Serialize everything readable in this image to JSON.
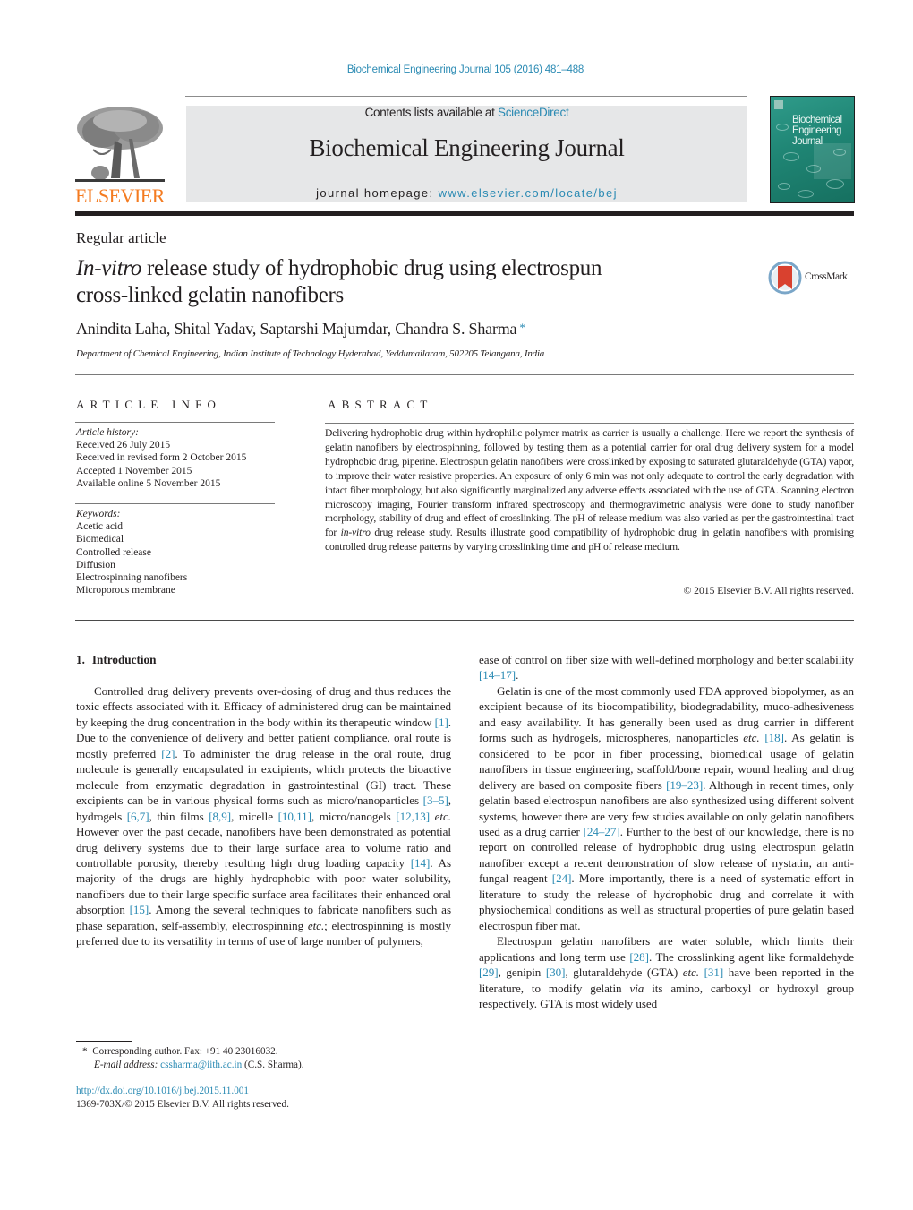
{
  "header": {
    "journal_ref": "Biochemical Engineering Journal 105 (2016) 481–488",
    "publisher_logo_text": "ELSEVIER",
    "contents_prefix": "Contents lists available at ",
    "contents_link": "ScienceDirect",
    "journal_title": "Biochemical Engineering Journal",
    "homepage_prefix": "journal homepage: ",
    "homepage_link": "www.elsevier.com/locate/bej",
    "cover_title_lines": [
      "Biochemical",
      "Engineering",
      "Journal"
    ],
    "crossmark_label": "CrossMark"
  },
  "colors": {
    "link": "#2a8ab3",
    "elsevier_orange": "#f47b20",
    "masthead_bg": "#e6e7e8",
    "cover_teal": "#1f8574",
    "text": "#231f20"
  },
  "article": {
    "type": "Regular article",
    "title_italic": "In-vitro",
    "title_rest_line1": " release study of hydrophobic drug using electrospun",
    "title_line2": "cross-linked gelatin nanofibers",
    "authors": "Anindita Laha, Shital Yadav, Saptarshi Majumdar, Chandra S. Sharma",
    "author_mark": "*",
    "affiliation": "Department of Chemical Engineering, Indian Institute of Technology Hyderabad, Yeddumailaram, 502205 Telangana, India"
  },
  "article_info": {
    "heading": "ARTICLE INFO",
    "history_label": "Article history:",
    "history": [
      "Received 26 July 2015",
      "Received in revised form 2 October 2015",
      "Accepted 1 November 2015",
      "Available online 5 November 2015"
    ],
    "keywords_label": "Keywords:",
    "keywords": [
      "Acetic acid",
      "Biomedical",
      "Controlled release",
      "Diffusion",
      "Electrospinning nanofibers",
      "Microporous membrane"
    ]
  },
  "abstract": {
    "heading": "ABSTRACT",
    "part1": "Delivering hydrophobic drug within hydrophilic polymer matrix as carrier is usually a challenge. Here we report the synthesis of gelatin nanofibers by electrospinning, followed by testing them as a potential carrier for oral drug delivery system for a model hydrophobic drug, piperine. Electrospun gelatin nanofibers were crosslinked by exposing to saturated glutaraldehyde (GTA) vapor, to improve their water resistive properties. An exposure of only 6 min was not only adequate to control the early degradation with intact fiber morphology, but also significantly marginalized any adverse effects associated with the use of GTA. Scanning electron microscopy imaging, Fourier transform infrared spectroscopy and thermogravimetric analysis were done to study nanofiber morphology, stability of drug and effect of crosslinking. The pH of release medium was also varied as per the gastrointestinal tract for ",
    "italic": "in-vitro",
    "part2": " drug release study. Results illustrate good compatibility of hydrophobic drug in gelatin nanofibers with promising controlled drug release patterns by varying crosslinking time and pH of release medium.",
    "copyright": "© 2015 Elsevier B.V. All rights reserved."
  },
  "body": {
    "section_number": "1.",
    "section_title": "Introduction",
    "left_p1": [
      {
        "t": "Controlled drug delivery prevents over-dosing of drug and thus reduces the toxic effects associated with it. Efficacy of administered drug can be maintained by keeping the drug concentration in the body within its therapeutic window "
      },
      {
        "r": "[1]"
      },
      {
        "t": ". Due to the convenience of delivery and better patient compliance, oral route is mostly preferred "
      },
      {
        "r": "[2]"
      },
      {
        "t": ". To administer the drug release in the oral route, drug molecule is generally encapsulated in excipients, which protects the bioactive molecule from enzymatic degradation in gastrointestinal (GI) tract. These excipients can be in various physical forms such as micro/nanoparticles "
      },
      {
        "r": "[3–5]"
      },
      {
        "t": ", hydrogels "
      },
      {
        "r": "[6,7]"
      },
      {
        "t": ", thin films "
      },
      {
        "r": "[8,9]"
      },
      {
        "t": ", micelle "
      },
      {
        "r": "[10,11]"
      },
      {
        "t": ", micro/nanogels "
      },
      {
        "r": "[12,13]"
      },
      {
        "t": " "
      },
      {
        "i": "etc."
      },
      {
        "t": " However over the past decade, nanofibers have been demonstrated as potential drug delivery systems due to their large surface area to volume ratio and controllable porosity, thereby resulting high drug loading capacity "
      },
      {
        "r": "[14]"
      },
      {
        "t": ". As majority of the drugs are highly hydrophobic with poor water solubility, nanofibers due to their large specific surface area facilitates their enhanced oral absorption "
      },
      {
        "r": "[15]"
      },
      {
        "t": ". Among the several techniques to fabricate nanofibers such as phase separation, self-assembly, electrospinning "
      },
      {
        "i": "etc."
      },
      {
        "t": "; electrospinning is mostly preferred due to its versatility in terms of use of large number of polymers,"
      }
    ],
    "right_p0": [
      {
        "t": "ease of control on fiber size with well-defined morphology and better scalability "
      },
      {
        "r": "[14–17]"
      },
      {
        "t": "."
      }
    ],
    "right_p1": [
      {
        "t": "Gelatin is one of the most commonly used FDA approved biopolymer, as an excipient because of its biocompatibility, biodegradability, muco-adhesiveness and easy availability. It has generally been used as drug carrier in different forms such as hydrogels, microspheres, nanoparticles "
      },
      {
        "i": "etc."
      },
      {
        "t": " "
      },
      {
        "r": "[18]"
      },
      {
        "t": ". As gelatin is considered to be poor in fiber processing, biomedical usage of gelatin nanofibers in tissue engineering, scaffold/bone repair, wound healing and drug delivery are based on composite fibers "
      },
      {
        "r": "[19–23]"
      },
      {
        "t": ". Although in recent times, only gelatin based electrospun nanofibers are also synthesized using different solvent systems, however there are very few studies available on only gelatin nanofibers used as a drug carrier "
      },
      {
        "r": "[24–27]"
      },
      {
        "t": ". Further to the best of our knowledge, there is no report on controlled release of hydrophobic drug using electrospun gelatin nanofiber except a recent demonstration of slow release of nystatin, an anti-fungal reagent "
      },
      {
        "r": "[24]"
      },
      {
        "t": ". More importantly, there is a need of systematic effort in literature to study the release of hydrophobic drug and correlate it with physiochemical conditions as well as structural properties of pure gelatin based electrospun fiber mat."
      }
    ],
    "right_p2": [
      {
        "t": "Electrospun gelatin nanofibers are water soluble, which limits their applications and long term use "
      },
      {
        "r": "[28]"
      },
      {
        "t": ". The crosslinking agent like formaldehyde "
      },
      {
        "r": "[29]"
      },
      {
        "t": ", genipin "
      },
      {
        "r": "[30]"
      },
      {
        "t": ", glutaraldehyde (GTA) "
      },
      {
        "i": "etc."
      },
      {
        "t": " "
      },
      {
        "r": "[31]"
      },
      {
        "t": " have been reported in the literature, to modify gelatin "
      },
      {
        "i": "via"
      },
      {
        "t": " its amino, carboxyl or hydroxyl group respectively. GTA is most widely used"
      }
    ]
  },
  "footnote": {
    "mark": "*",
    "corresponding": "Corresponding author. Fax: +91 40 23016032.",
    "email_label": "E-mail address:",
    "email": "cssharma@iith.ac.in",
    "email_suffix": "(C.S. Sharma)."
  },
  "doi": {
    "link": "http://dx.doi.org/10.1016/j.bej.2015.11.001",
    "issn_line": "1369-703X/© 2015 Elsevier B.V. All rights reserved."
  }
}
